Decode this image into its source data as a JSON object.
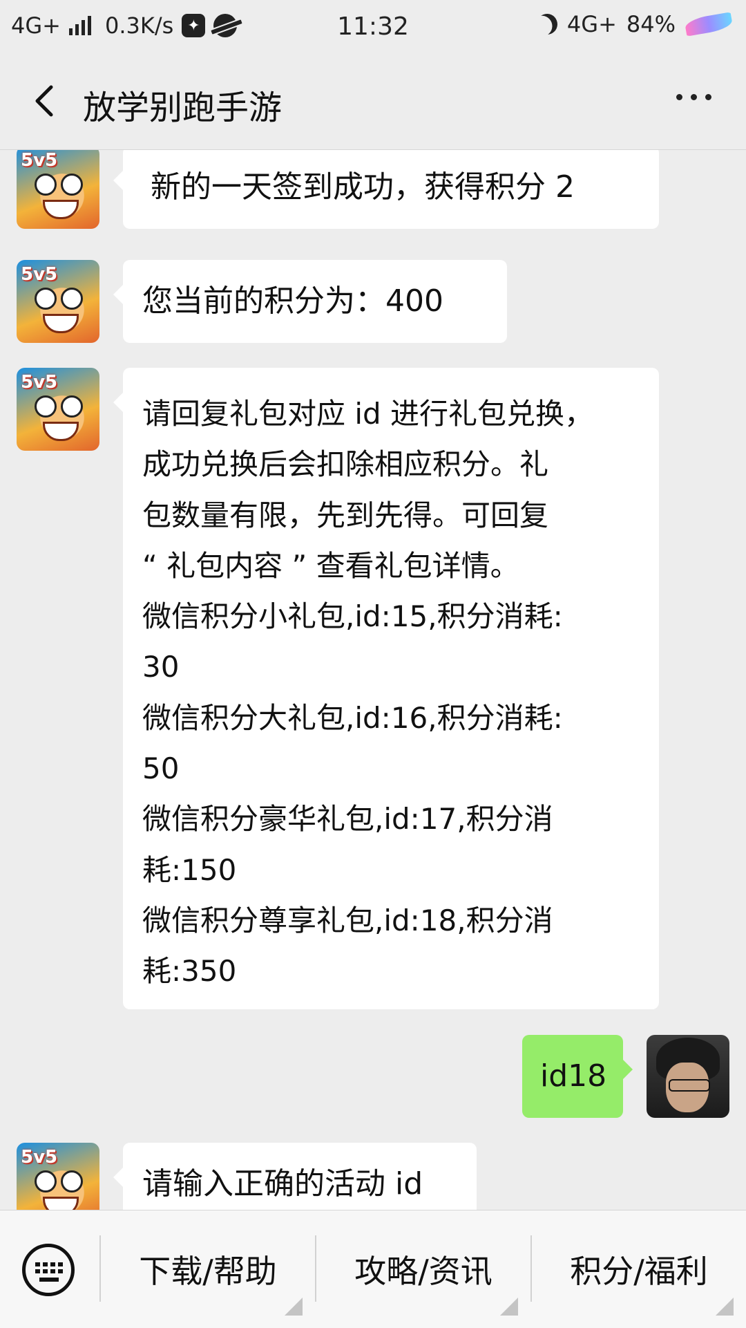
{
  "status_bar": {
    "network_left": "4G+",
    "speed": "0.3K/s",
    "time": "11:32",
    "network_right": "4G+",
    "battery": "84%"
  },
  "header": {
    "title": "放学别跑手游"
  },
  "messages": [
    {
      "from": "bot",
      "lines": [
        "新的一天签到成功，获得积分 2"
      ]
    },
    {
      "from": "bot",
      "lines": [
        "您当前的积分为：400"
      ]
    },
    {
      "from": "bot",
      "lines": [
        "请回复礼包对应 id 进行礼包兑换，",
        "成功兑换后会扣除相应积分。礼",
        "包数量有限，先到先得。可回复",
        "“ 礼包内容 ” 查看礼包详情。",
        "微信积分小礼包,id:15,积分消耗:",
        "30",
        "微信积分大礼包,id:16,积分消耗:",
        "50",
        "微信积分豪华礼包,id:17,积分消",
        "耗:150",
        "微信积分尊享礼包,id:18,积分消",
        "耗:350"
      ]
    },
    {
      "from": "user",
      "lines": [
        "id18"
      ]
    },
    {
      "from": "bot",
      "lines": [
        "请输入正确的活动 id"
      ]
    }
  ],
  "bottom_menu": {
    "items": [
      "下载/帮助",
      "攻略/资讯",
      "积分/福利"
    ]
  }
}
